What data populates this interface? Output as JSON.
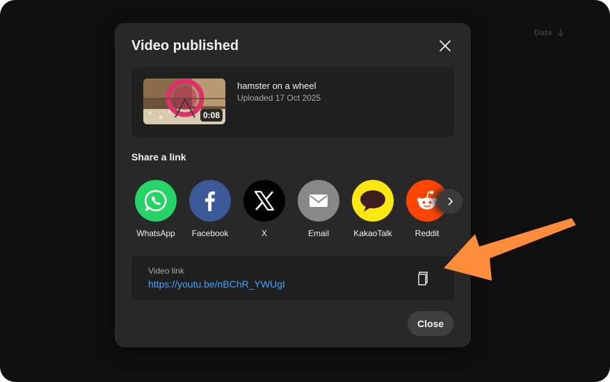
{
  "background": {
    "sort_label": "Date"
  },
  "dialog": {
    "title": "Video published",
    "video": {
      "title": "hamster on a wheel",
      "uploaded": "Uploaded 17 Oct 2025",
      "duration": "0:08"
    },
    "share_heading": "Share a link",
    "share_targets": [
      {
        "label": "WhatsApp",
        "color": "#25d366",
        "icon": "whatsapp-icon"
      },
      {
        "label": "Facebook",
        "color": "#3b5998",
        "icon": "facebook-icon"
      },
      {
        "label": "X",
        "color": "#000000",
        "icon": "x-icon"
      },
      {
        "label": "Email",
        "color": "#888888",
        "icon": "email-icon"
      },
      {
        "label": "KakaoTalk",
        "color": "#ffe812",
        "icon": "kakaotalk-icon"
      },
      {
        "label": "Reddit",
        "color": "#ff4500",
        "icon": "reddit-icon"
      }
    ],
    "link": {
      "label": "Video link",
      "url": "https://youtu.be/nBChR_YWUgI"
    },
    "close_label": "Close"
  },
  "annotation": {
    "arrow_color": "#ff8c3a"
  }
}
